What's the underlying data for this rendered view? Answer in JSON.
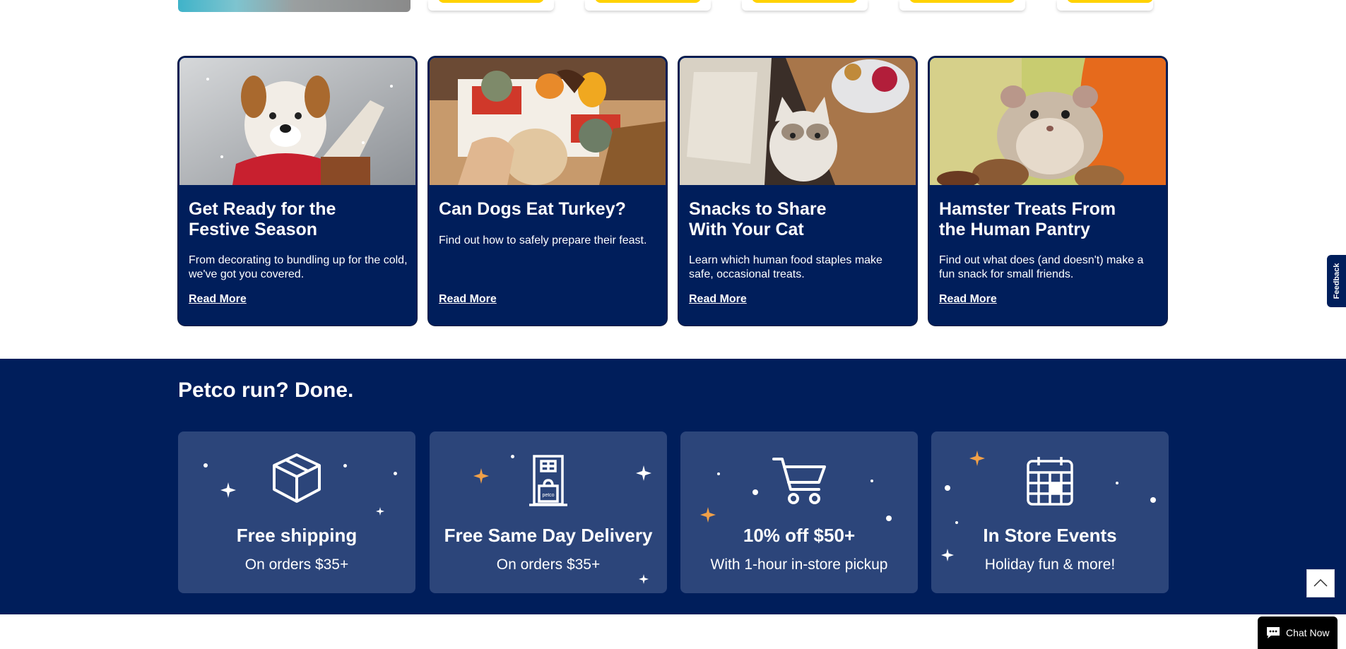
{
  "articles": [
    {
      "title": "Get Ready for the Festive Season",
      "title_lines": [
        "Get Ready for the",
        "Festive Season"
      ],
      "body": "From decorating to bundling up for the cold, we've got you covered.",
      "link": "Read More"
    },
    {
      "title": "Can Dogs Eat Turkey?",
      "title_lines": [
        "Can Dogs Eat Turkey?",
        ""
      ],
      "body": "Find out how to safely prepare their feast.",
      "link": "Read More"
    },
    {
      "title": "Snacks to Share With Your Cat",
      "title_lines": [
        "Snacks to Share",
        "With Your Cat"
      ],
      "body": "Learn which human food staples make safe, occasional treats.",
      "link": "Read More"
    },
    {
      "title": "Hamster Treats From the Human Pantry",
      "title_lines": [
        "Hamster Treats From",
        "the Human Pantry"
      ],
      "body": "Find out what does (and doesn't) make a fun snack for small friends.",
      "link": "Read More"
    }
  ],
  "banner": {
    "heading": "Petco run? Done.",
    "features": [
      {
        "title": "Free shipping",
        "subtitle": "On orders $35+",
        "icon": "box-icon"
      },
      {
        "title": "Free Same Day Delivery",
        "subtitle": "On orders $35+",
        "icon": "door-bag-icon",
        "icon_label": "petco"
      },
      {
        "title": "10% off $50+",
        "subtitle": "With 1-hour in-store pickup",
        "icon": "cart-icon"
      },
      {
        "title": "In Store Events",
        "subtitle": "Holiday fun & more!",
        "icon": "calendar-icon"
      }
    ]
  },
  "widgets": {
    "feedback_label": "Feedback",
    "chat_label": "Chat Now"
  },
  "colors": {
    "navy": "#001e5b",
    "feature_card": "#2c457a",
    "accent_yellow": "#ffd200",
    "accent_orange": "#f0a048"
  }
}
